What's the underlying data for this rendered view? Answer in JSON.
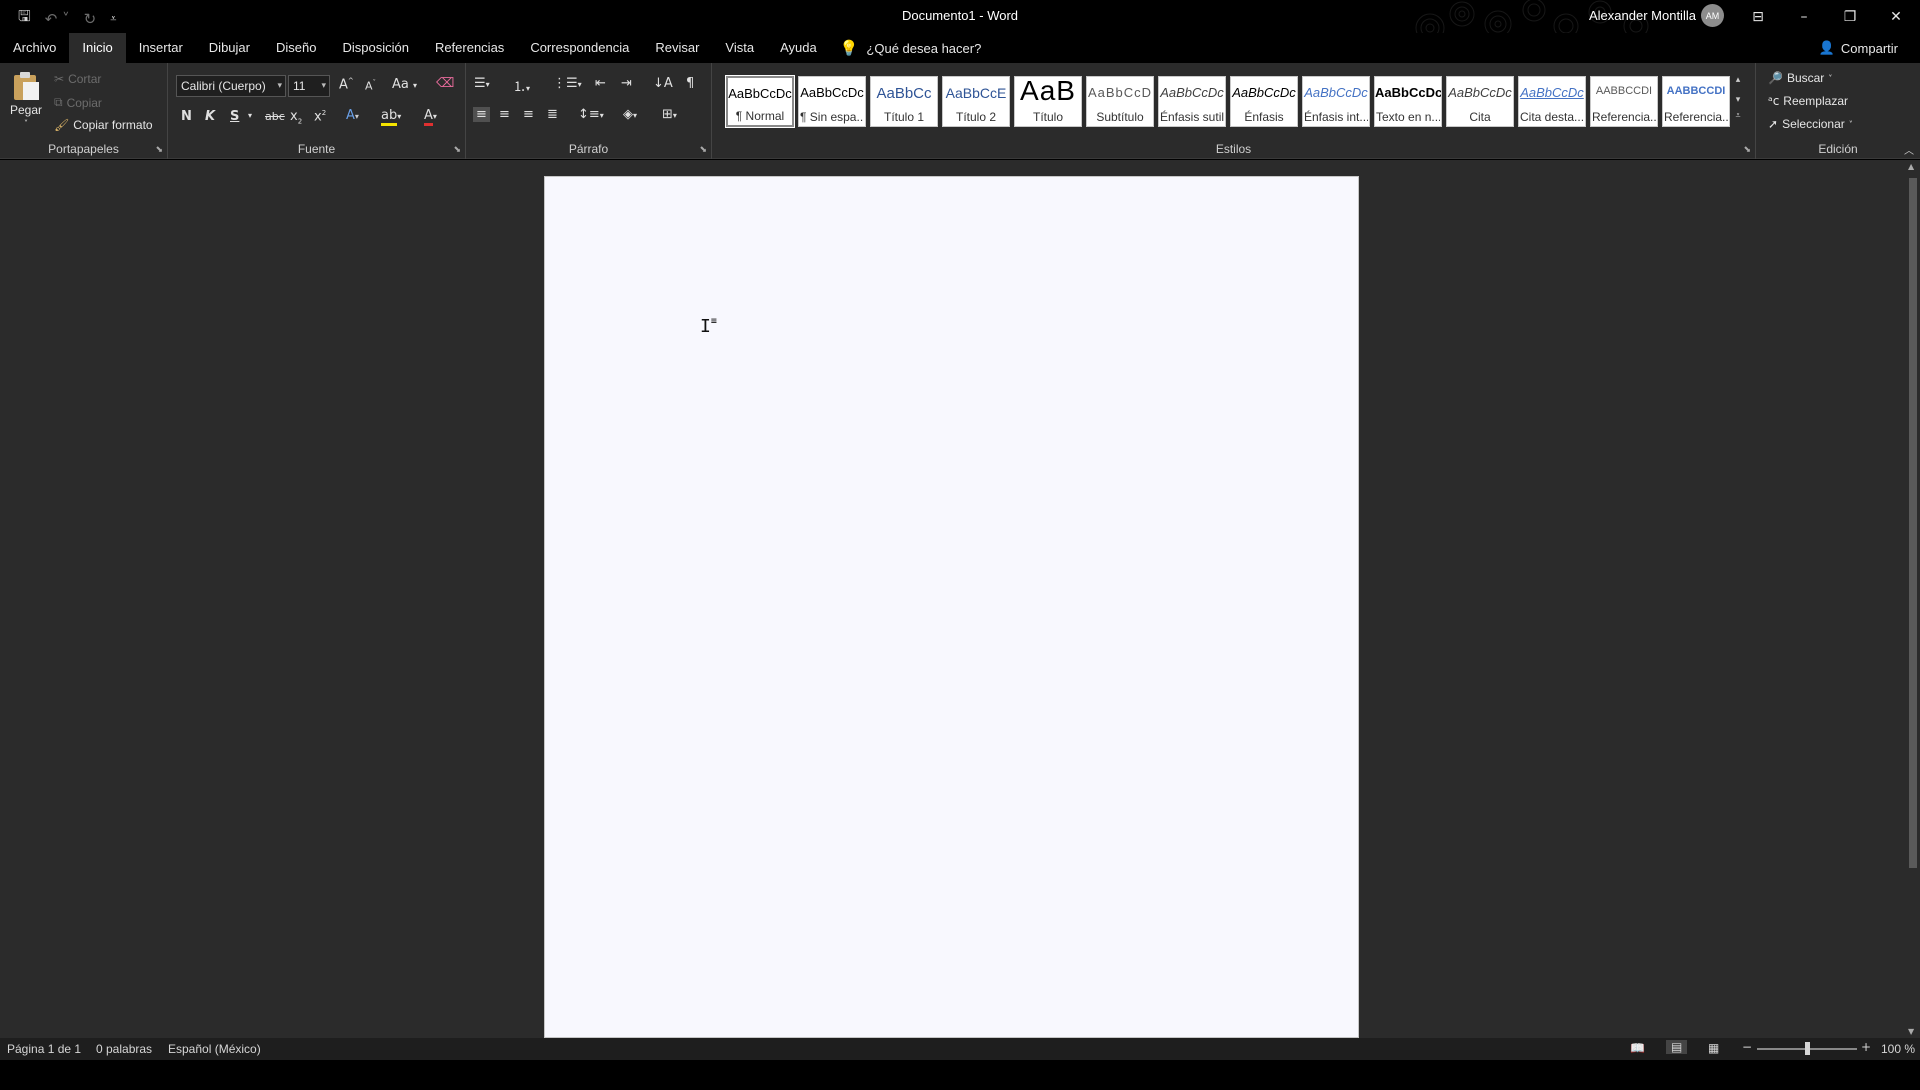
{
  "titlebar": {
    "doc_title": "Documento1  -  Word",
    "user_name": "Alexander Montilla",
    "avatar_initials": "AM"
  },
  "tabs": [
    "Archivo",
    "Inicio",
    "Insertar",
    "Dibujar",
    "Diseño",
    "Disposición",
    "Referencias",
    "Correspondencia",
    "Revisar",
    "Vista",
    "Ayuda"
  ],
  "active_tab": "Inicio",
  "tell_me": "¿Qué desea hacer?",
  "share_label": "Compartir",
  "clipboard": {
    "paste": "Pegar",
    "cut": "Cortar",
    "copy": "Copiar",
    "format_painter": "Copiar formato",
    "label": "Portapapeles"
  },
  "font": {
    "family": "Calibri (Cuerpo)",
    "size": "11",
    "label": "Fuente",
    "bold": "N",
    "italic": "K",
    "underline": "S",
    "strike": "abc",
    "case": "Aa"
  },
  "paragraph": {
    "label": "Párrafo"
  },
  "styles": {
    "label": "Estilos",
    "items": [
      {
        "sample": "AaBbCcDc",
        "name": "¶ Normal"
      },
      {
        "sample": "AaBbCcDc",
        "name": "¶ Sin espa..."
      },
      {
        "sample": "AaBbCc",
        "name": "Título 1"
      },
      {
        "sample": "AaBbCcE",
        "name": "Título 2"
      },
      {
        "sample": "AaB",
        "name": "Título"
      },
      {
        "sample": "AaBbCcD",
        "name": "Subtítulo"
      },
      {
        "sample": "AaBbCcDc",
        "name": "Énfasis sutil"
      },
      {
        "sample": "AaBbCcDc",
        "name": "Énfasis"
      },
      {
        "sample": "AaBbCcDc",
        "name": "Énfasis int..."
      },
      {
        "sample": "AaBbCcDc",
        "name": "Texto en n..."
      },
      {
        "sample": "AaBbCcDc",
        "name": "Cita"
      },
      {
        "sample": "AaBbCcDc",
        "name": "Cita desta..."
      },
      {
        "sample": "AABBCCDI",
        "name": "Referencia..."
      },
      {
        "sample": "AABBCCDI",
        "name": "Referencia..."
      }
    ]
  },
  "editing": {
    "label": "Edición",
    "find": "Buscar",
    "replace": "Reemplazar",
    "select": "Seleccionar"
  },
  "status": {
    "page": "Página 1 de 1",
    "words": "0 palabras",
    "language": "Español (México)",
    "zoom": "100 %"
  }
}
